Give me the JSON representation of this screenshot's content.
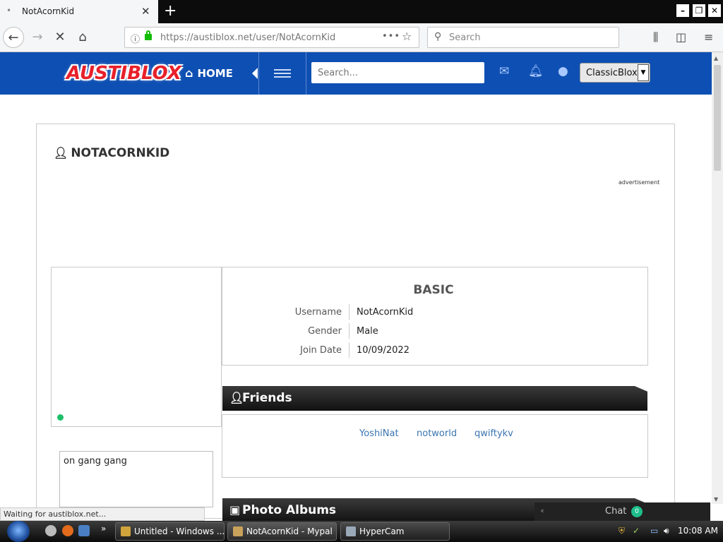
{
  "browser": {
    "tab_title": "NotAcornKid",
    "url": "https://austiblox.net/user/NotAcornKid",
    "search_placeholder": "Search",
    "status_text": "Waiting for austiblox.net..."
  },
  "site": {
    "logo_text": "AUSTIBLOX",
    "home_label": "HOME",
    "search_placeholder": "Search...",
    "theme_selected": "ClassicBlox"
  },
  "profile": {
    "username_heading": "NOTACORNKID",
    "advertisement_label": "advertisement",
    "status_message": "on gang gang",
    "basic": {
      "title": "BASIC",
      "rows": [
        {
          "label": "Username",
          "value": "NotAcornKid"
        },
        {
          "label": "Gender",
          "value": "Male"
        },
        {
          "label": "Join Date",
          "value": "10/09/2022"
        }
      ]
    },
    "friends_title": "Friends",
    "friends": [
      "YoshiNat",
      "notworld",
      "qwiftykv"
    ],
    "photo_albums_title": "Photo Albums"
  },
  "chat": {
    "label": "Chat",
    "count": "0"
  },
  "taskbar": {
    "tasks": [
      "Untitled - Windows ...",
      "NotAcornKid - Mypal",
      "HyperCam"
    ],
    "clock": "10:08 AM"
  },
  "colors": {
    "header_blue": "#0e4fb3",
    "online_green": "#1dbf6b",
    "friend_link": "#3a75b0"
  },
  "icons": [
    "home-icon",
    "envelope-icon",
    "bell-icon",
    "user-icon",
    "search-icon",
    "star-icon",
    "camera-icon"
  ]
}
